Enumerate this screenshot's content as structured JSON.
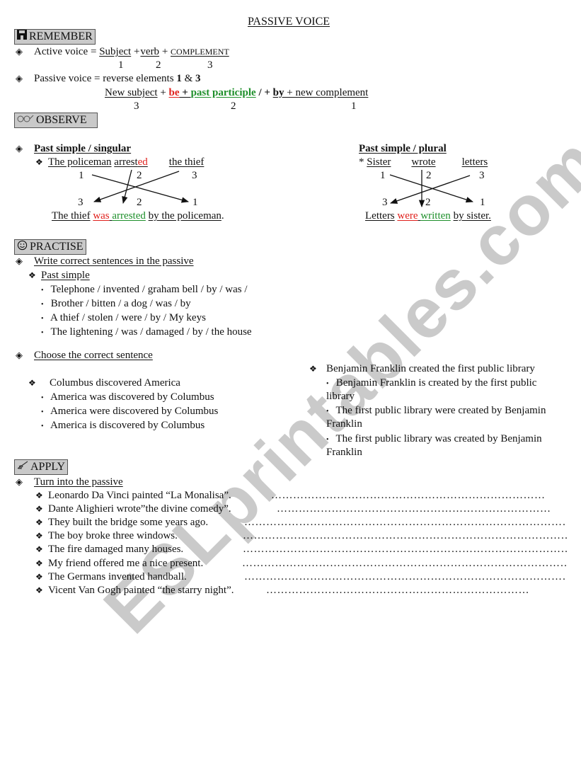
{
  "title": "PASSIVE VOICE",
  "remember": {
    "header": "REMEMBER",
    "icon": "floppy-disk-icon",
    "active_label": "Active voice = ",
    "active_parts": [
      "Subject",
      "verb",
      "COMPLEMENT"
    ],
    "plus": "+",
    "active_nums": [
      "1",
      "2",
      "3"
    ],
    "passive_label": "Passive voice = reverse elements ",
    "passive_bold1": "1",
    "passive_amp": " & ",
    "passive_bold3": "3",
    "formula": {
      "new_subject": "New subject",
      "be": "be",
      "plus_sep": " + ",
      "past_participle": "past participle",
      "slash": " / + ",
      "by": "by",
      "new_complement": " + new complement"
    },
    "formula_nums": [
      "3",
      "2",
      "1"
    ]
  },
  "observe": {
    "header": "OBSERVE",
    "icon": "glasses-icon",
    "singular": {
      "title": "Past simple / singular",
      "active": [
        "The policeman",
        "arrest",
        "ed",
        "the thief"
      ],
      "top_nums": [
        "1",
        "2",
        "3"
      ],
      "bottom_nums": [
        "3",
        "2",
        "1"
      ],
      "passive": [
        "The thief",
        "was",
        "arrested",
        "by the policeman",
        "."
      ]
    },
    "plural": {
      "title": "Past simple / plural",
      "star": "* ",
      "active": [
        "Sister",
        "wrote",
        "letters"
      ],
      "top_nums": [
        "1",
        "2",
        "3"
      ],
      "bottom_nums": [
        "3",
        "2",
        "1"
      ],
      "passive": [
        "Letters",
        "were",
        "written",
        "by sister."
      ]
    }
  },
  "practise": {
    "header": "PRACTISE",
    "icon": "smiley-icon",
    "task1": "Write correct sentences in the passive",
    "sub1": "Past simple",
    "items1": [
      "Telephone / invented / graham bell / by / was /",
      "Brother / bitten / a dog / was / by",
      "A thief / stolen / were / by / My keys",
      "The lightening / was / damaged / by / the house"
    ],
    "task2": "Choose the correct sentence",
    "q1": {
      "prompt": "Columbus discovered America",
      "options": [
        "America was discovered by Columbus",
        "America were discovered by Columbus",
        "America is discovered by Columbus"
      ]
    },
    "q2": {
      "prompt": "Benjamin Franklin created the first public library",
      "options": [
        [
          "Benjamin Franklin is created by the first public",
          "library"
        ],
        [
          "The first public library were created by Benjamin",
          "Franklin"
        ],
        [
          "The first public library was created by Benjamin",
          "Franklin"
        ]
      ]
    }
  },
  "apply": {
    "header": "APPLY",
    "icon": "writing-hand-icon",
    "task": "Turn into the passive",
    "items": [
      {
        "sentence": "Leonardo Da Vinci painted “La Monalisa”.",
        "blank": "…………………………………………………………………………………………………………………….."
      },
      {
        "sentence": "Dante Alighieri wrote”the divine comedy”.",
        "blank": "………………………………………………………………………………………………………………….."
      },
      {
        "sentence": "They built the bridge some years ago.",
        "blank": "………………………………………………………………………………………………………………………………….."
      },
      {
        "sentence": "The boy broke three windows.",
        "blank": "…………………………………………………………………………………………………………………………………..."
      },
      {
        "sentence": "The fire damaged many houses.",
        "blank": "…………………………………………………………………………………………………………………………………..."
      },
      {
        "sentence": "My friend offered me a nice present.",
        "blank": "…………………………………………………………………………………………………………………………………..."
      },
      {
        "sentence": "The Germans invented handball.",
        "blank": "………………………………………………………………………………………………………………………………….."
      },
      {
        "sentence": "Vicent Van Gogh painted “the starry night”.",
        "blank": "……………………………………………………………………………………………………………………………….."
      }
    ]
  },
  "symbols": {
    "diamond": "◈",
    "four_diamond": "❖",
    "dot": "•"
  },
  "watermark": "ESLprintables.com"
}
